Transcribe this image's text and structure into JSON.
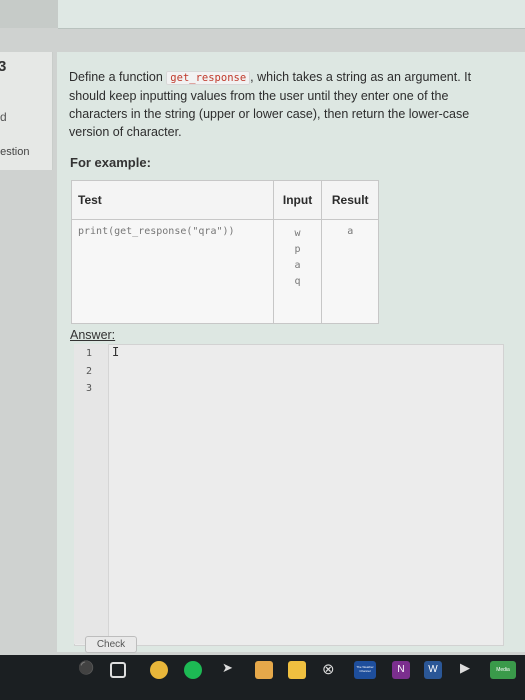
{
  "sidebar": {
    "question_number": "3",
    "mark_fragment": "d",
    "flag_fragment": "uestion"
  },
  "question": {
    "desc_prefix": "Define a function ",
    "function_name": "get_response",
    "desc_suffix": ", which takes a string as an argument. It should keep inputting values from the user until they enter one of the characters in the string (upper or lower case), then return the lower-case version of character.",
    "example_label": "For example:"
  },
  "examples": {
    "headers": [
      "Test",
      "Input",
      "Result"
    ],
    "test_code": "print(get_response(\"qra\"))",
    "inputs": [
      "w",
      "p",
      "a",
      "q"
    ],
    "result": "a"
  },
  "answer": {
    "label": "Answer:",
    "line_numbers": [
      "1",
      "2",
      "3"
    ],
    "cursor_glyph": "I"
  },
  "buttons": {
    "check": "Check"
  },
  "taskbar": {
    "icons": [
      "mic-icon",
      "task-view-icon",
      "chrome-icon",
      "spotify-icon",
      "mail-icon",
      "files-icon",
      "store-icon",
      "xbox-icon",
      "weather-icon",
      "onenote-icon",
      "word-icon",
      "arrow-icon",
      "media-icon"
    ],
    "weather_label": "The Weather Channel",
    "onenote_label": "N",
    "word_label": "W",
    "media_label": "Media"
  },
  "colors": {
    "panel_bg": "#dde7e2",
    "code_accent": "#c0392b",
    "taskbar_bg": "#1b1f22"
  }
}
